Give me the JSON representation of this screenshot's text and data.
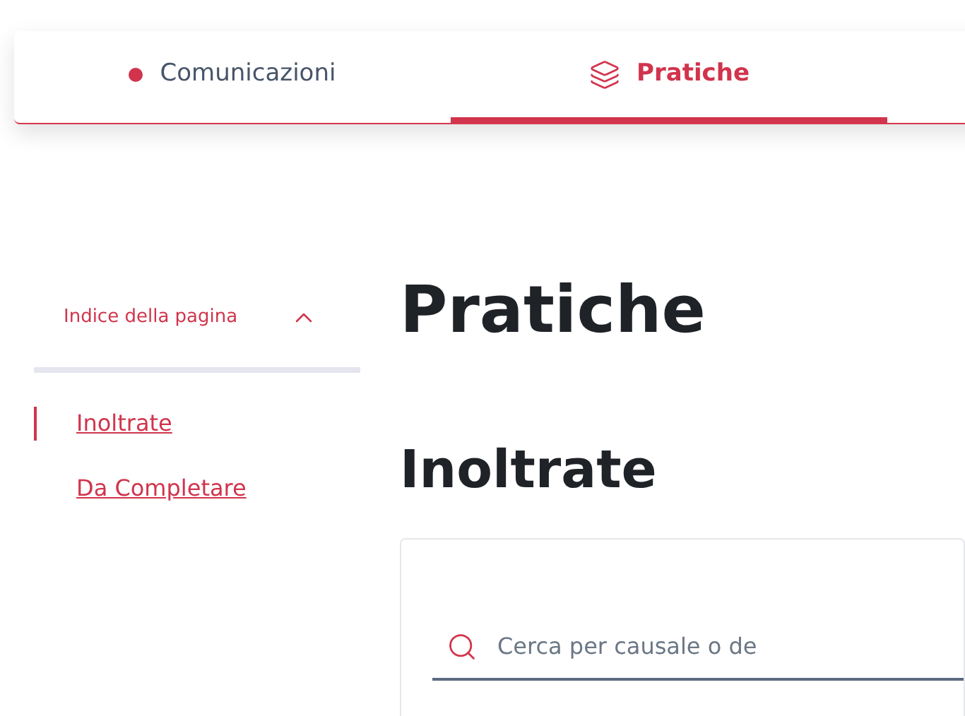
{
  "tabs": [
    {
      "label": "Comunicazioni",
      "kind": "dot",
      "selected": false
    },
    {
      "label": "Pratiche",
      "kind": "layers",
      "selected": true
    }
  ],
  "page_index": {
    "title": "Indice della pagina",
    "expanded": true,
    "items": [
      {
        "label": "Inoltrate",
        "selected": true
      },
      {
        "label": "Da Completare",
        "selected": false
      }
    ]
  },
  "heading": "Pratiche",
  "section": {
    "title": "Inoltrate",
    "search": {
      "placeholder": "Cerca per causale o de"
    }
  }
}
